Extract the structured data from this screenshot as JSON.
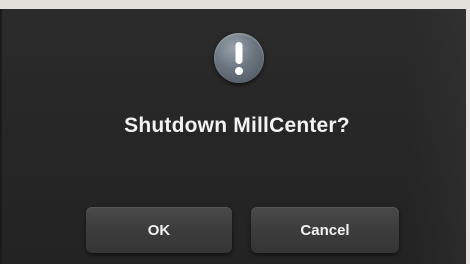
{
  "dialog": {
    "icon": "exclamation-icon",
    "title": "Shutdown MillCenter?",
    "buttons": {
      "ok_label": "OK",
      "cancel_label": "Cancel"
    }
  },
  "colors": {
    "dialog_background": "#272727",
    "button_background": "#404040",
    "text": "#f2f2f2",
    "icon": "#6b7580"
  }
}
